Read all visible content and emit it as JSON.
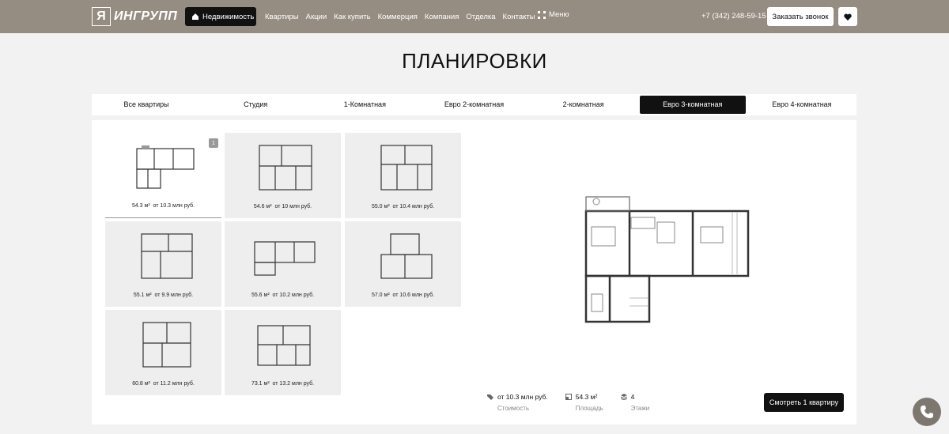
{
  "header": {
    "logo_mark": "Я",
    "logo_text": "ИНГРУПП",
    "active_nav": "Недвижимость",
    "nav": [
      "Квартиры",
      "Акции",
      "Как купить",
      "Коммерция",
      "Компания",
      "Отделка",
      "Контакты"
    ],
    "menu_label": "Меню",
    "phone": "+7 (342) 248-59-15",
    "callback_label": "Заказать звонок"
  },
  "page_title": "ПЛАНИРОВКИ",
  "tabs": [
    "Все квартиры",
    "Студия",
    "1-Комнатная",
    "Евро 2-комнатная",
    "2-комнатная",
    "Евро 3-комнатная",
    "Евро 4-комнатная"
  ],
  "active_tab": "Евро 3-комнатная",
  "cards": [
    {
      "area": "54.3 м²",
      "price": "от 10.3 млн руб.",
      "badge": "1"
    },
    {
      "area": "54.6 м²",
      "price": "от 10 млн руб."
    },
    {
      "area": "55.0 м²",
      "price": "от 10.4 млн руб."
    },
    {
      "area": "55.1 м²",
      "price": "от 9.9 млн руб."
    },
    {
      "area": "55.6 м²",
      "price": "от 10.2 млн руб."
    },
    {
      "area": "57.0 м²",
      "price": "от 10.6 млн руб."
    },
    {
      "area": "60.8 м²",
      "price": "от 11.2 млн руб."
    },
    {
      "area": "73.1 м²",
      "price": "от 13.2 млн руб."
    }
  ],
  "stats": {
    "price_value": "от 10.3 млн руб.",
    "price_label": "Стоимость",
    "area_value": "54.3 м²",
    "area_label": "Площадь",
    "floors_value": "4",
    "floors_label": "Этажи"
  },
  "view_button": "Смотреть 1 квартиру",
  "colors": {
    "header_bg": "#968d82",
    "accent": "#111111",
    "float_button": "#7d776f"
  },
  "icons": [
    "home-icon",
    "menu-grid-icon",
    "heart-icon",
    "tag-icon",
    "area-icon",
    "layers-icon",
    "phone-icon"
  ]
}
